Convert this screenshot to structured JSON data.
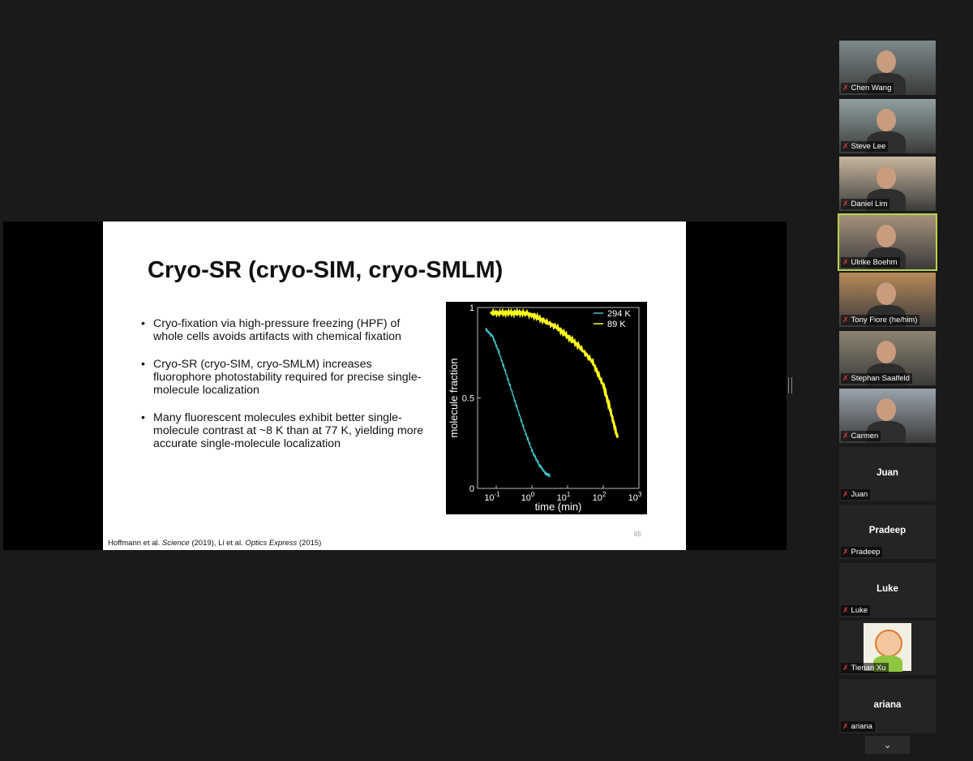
{
  "slide": {
    "title": "Cryo-SR (cryo-SIM, cryo-SMLM)",
    "bullets": [
      "Cryo-fixation via high-pressure freezing (HPF) of whole cells avoids artifacts with chemical fixation",
      "Cryo-SR (cryo-SIM, cryo-SMLM) increases fluorophore photostability required for precise single-molecule localization",
      "Many fluorescent molecules exhibit better single-molecule contrast at ~8 K than at 77 K, yielding more accurate single-molecule localization"
    ],
    "citation": {
      "a1": "Hoffmann et al. ",
      "j1": "Science",
      "a2": " (2019), Li et al. ",
      "j2": "Optics Express",
      "a3": " (2015)"
    },
    "page_number": "65"
  },
  "chart_data": {
    "type": "line",
    "xlabel": "time (min)",
    "ylabel": "molecule fraction",
    "xscale": "log",
    "xlim": [
      0.03,
      1000
    ],
    "ylim": [
      0,
      1
    ],
    "x_ticks": [
      {
        "base": "10",
        "exp": "-1",
        "v": 0.1
      },
      {
        "base": "10",
        "exp": "0",
        "v": 1
      },
      {
        "base": "10",
        "exp": "1",
        "v": 10
      },
      {
        "base": "10",
        "exp": "2",
        "v": 100
      },
      {
        "base": "10",
        "exp": "3",
        "v": 1000
      }
    ],
    "y_ticks": [
      {
        "label": "0",
        "v": 0
      },
      {
        "label": "0.5",
        "v": 0.5
      },
      {
        "label": "1",
        "v": 1
      }
    ],
    "legend_position": "top-right",
    "series": [
      {
        "name": "294 K",
        "color": "#3fc9cf",
        "x": [
          0.05,
          0.08,
          0.12,
          0.2,
          0.35,
          0.6,
          1.0,
          1.6,
          2.5,
          3.2
        ],
        "y": [
          0.88,
          0.84,
          0.75,
          0.62,
          0.47,
          0.33,
          0.21,
          0.13,
          0.08,
          0.07
        ]
      },
      {
        "name": "89 K",
        "color": "#ffff1a",
        "x": [
          0.07,
          0.15,
          0.3,
          0.6,
          1.0,
          2,
          5,
          10,
          20,
          50,
          100,
          150,
          250
        ],
        "y": [
          0.97,
          0.97,
          0.97,
          0.97,
          0.96,
          0.93,
          0.89,
          0.84,
          0.79,
          0.7,
          0.57,
          0.45,
          0.28
        ]
      }
    ]
  },
  "participants": [
    {
      "name": "Chen Wang",
      "video": true,
      "bg": "#7d8a8c"
    },
    {
      "name": "Steve Lee",
      "video": true,
      "bg": "#8fa1a0"
    },
    {
      "name": "Daniel Lim",
      "video": true,
      "bg": "#c9b79e"
    },
    {
      "name": "Ulrike Boehm",
      "video": true,
      "bg": "#a5917c",
      "active": true
    },
    {
      "name": "Tony Fiore (he/him)",
      "video": true,
      "bg": "#b88a5a"
    },
    {
      "name": "Stephan Saalfeld",
      "video": true,
      "bg": "#8d8470"
    },
    {
      "name": "Carmen",
      "video": true,
      "bg": "#9aa3ad"
    },
    {
      "name": "Juan",
      "video": false
    },
    {
      "name": "Pradeep",
      "video": false
    },
    {
      "name": "Luke",
      "video": false
    },
    {
      "name": "Tienan Xu",
      "video": false,
      "avatar": true
    },
    {
      "name": "ariana",
      "video": false
    }
  ],
  "scroll_button": "⌄"
}
